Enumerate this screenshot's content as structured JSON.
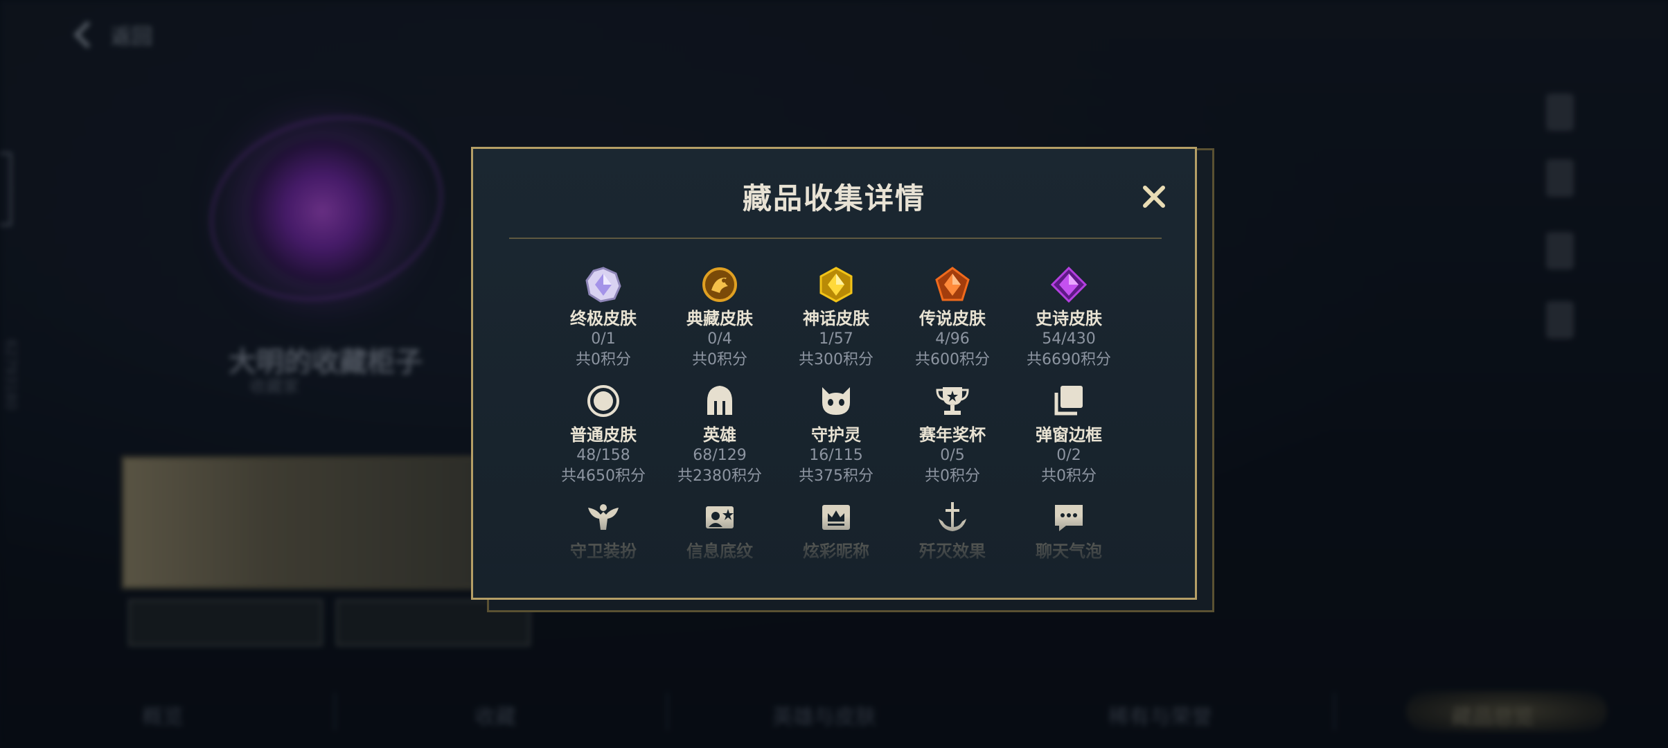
{
  "background": {
    "back_label": "返回",
    "side_id": "62793180",
    "player_name": "大明的收藏柜子",
    "player_sub": "收藏家",
    "bottom_tabs": [
      "概览",
      "收藏",
      "英雄与皮肤",
      "稀有与荣誉",
      "藏品总览"
    ]
  },
  "modal": {
    "title": "藏品收集详情",
    "close_icon": "close-icon",
    "items": [
      {
        "name": "终极皮肤",
        "count": "0/1",
        "points": "共0积分",
        "icon": "ultimate-skin-icon",
        "color": "#c7b9ff"
      },
      {
        "name": "典藏皮肤",
        "count": "0/4",
        "points": "共0积分",
        "icon": "treasured-skin-icon",
        "color": "#e0a022"
      },
      {
        "name": "神话皮肤",
        "count": "1/57",
        "points": "共300积分",
        "icon": "mythic-skin-icon",
        "color": "#f2c318"
      },
      {
        "name": "传说皮肤",
        "count": "4/96",
        "points": "共600积分",
        "icon": "legend-skin-icon",
        "color": "#f06a1c"
      },
      {
        "name": "史诗皮肤",
        "count": "54/430",
        "points": "共6690积分",
        "icon": "epic-skin-icon",
        "color": "#b43fe0"
      },
      {
        "name": "普通皮肤",
        "count": "48/158",
        "points": "共4650积分",
        "icon": "normal-skin-icon",
        "color": "#e6dfcf"
      },
      {
        "name": "英雄",
        "count": "68/129",
        "points": "共2380积分",
        "icon": "hero-helmet-icon",
        "color": "#e6dfcf"
      },
      {
        "name": "守护灵",
        "count": "16/115",
        "points": "共375积分",
        "icon": "guardian-spirit-icon",
        "color": "#e6dfcf"
      },
      {
        "name": "赛年奖杯",
        "count": "0/5",
        "points": "共0积分",
        "icon": "trophy-icon",
        "color": "#e6dfcf"
      },
      {
        "name": "弹窗边框",
        "count": "0/2",
        "points": "共0积分",
        "icon": "popup-frame-icon",
        "color": "#e6dfcf"
      },
      {
        "name": "守卫装扮",
        "icon": "guard-outfit-icon",
        "color": "#d9d2c0"
      },
      {
        "name": "信息底纹",
        "icon": "info-pattern-icon",
        "color": "#d9d2c0"
      },
      {
        "name": "炫彩昵称",
        "icon": "colorful-nickname-icon",
        "color": "#d9d2c0"
      },
      {
        "name": "歼灭效果",
        "icon": "annihilation-effect-icon",
        "color": "#d9d2c0"
      },
      {
        "name": "聊天气泡",
        "icon": "chat-bubble-icon",
        "color": "#d9d2c0"
      }
    ]
  }
}
